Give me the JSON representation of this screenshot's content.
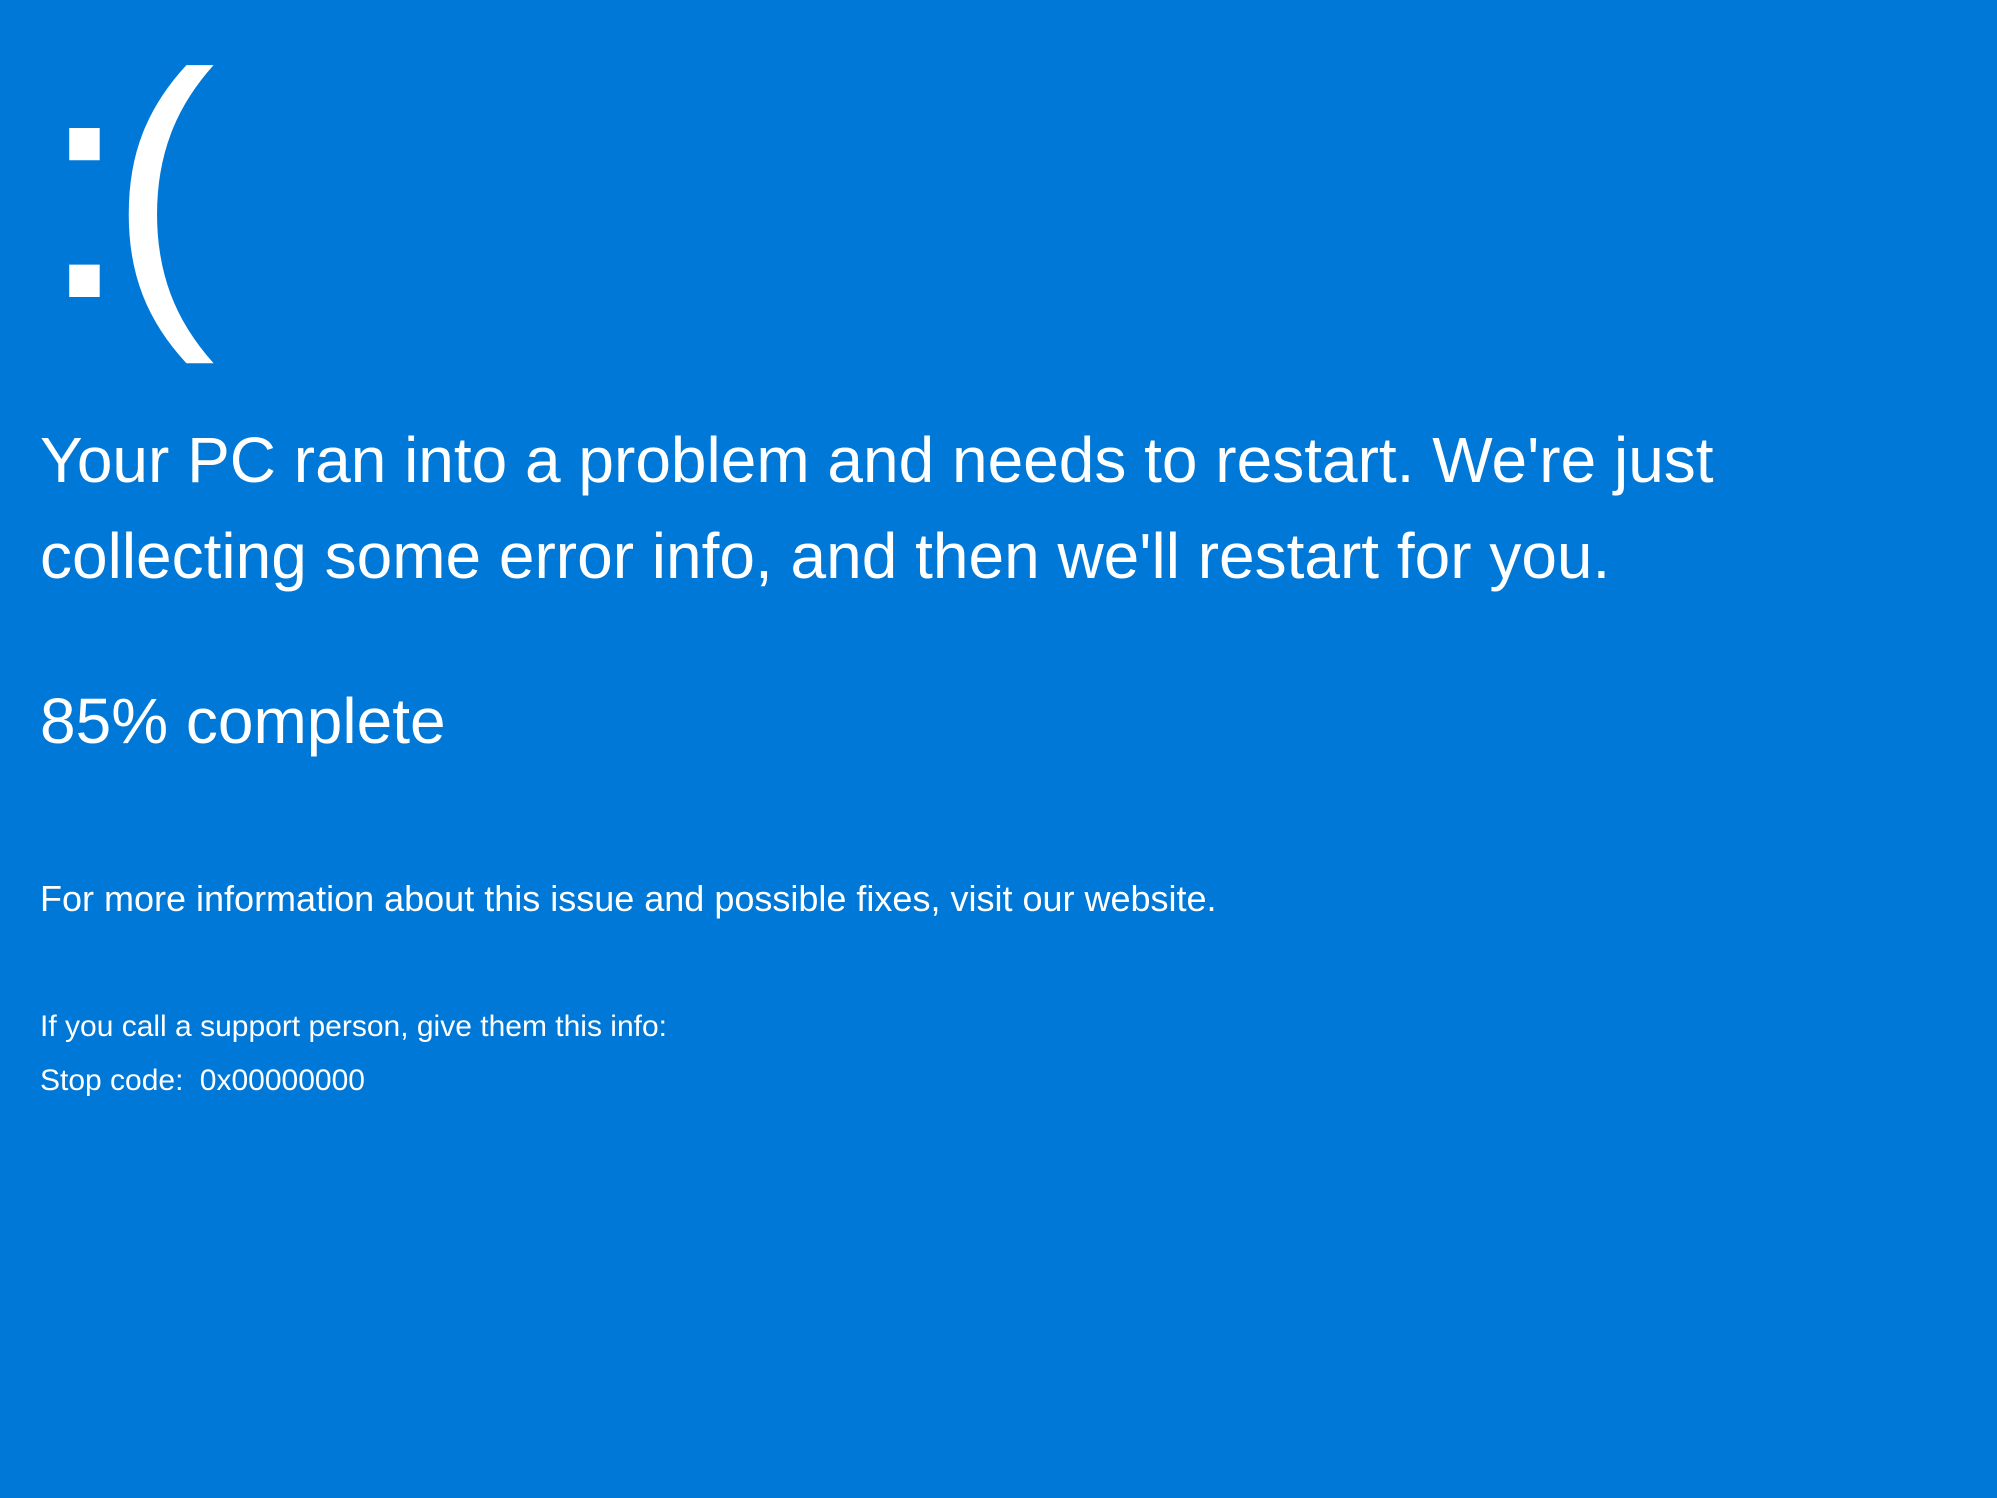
{
  "bsod": {
    "sad_face": ":(",
    "message": "Your PC ran into a problem and needs to restart. We're just collecting some error info, and then we'll restart for you.",
    "progress": "85% complete",
    "more_info": "For more information about this issue and possible fixes, visit our website.",
    "support_info": "If you call a support person, give them this info:",
    "stop_code_label": "Stop code:",
    "stop_code_value": "0x00000000"
  }
}
